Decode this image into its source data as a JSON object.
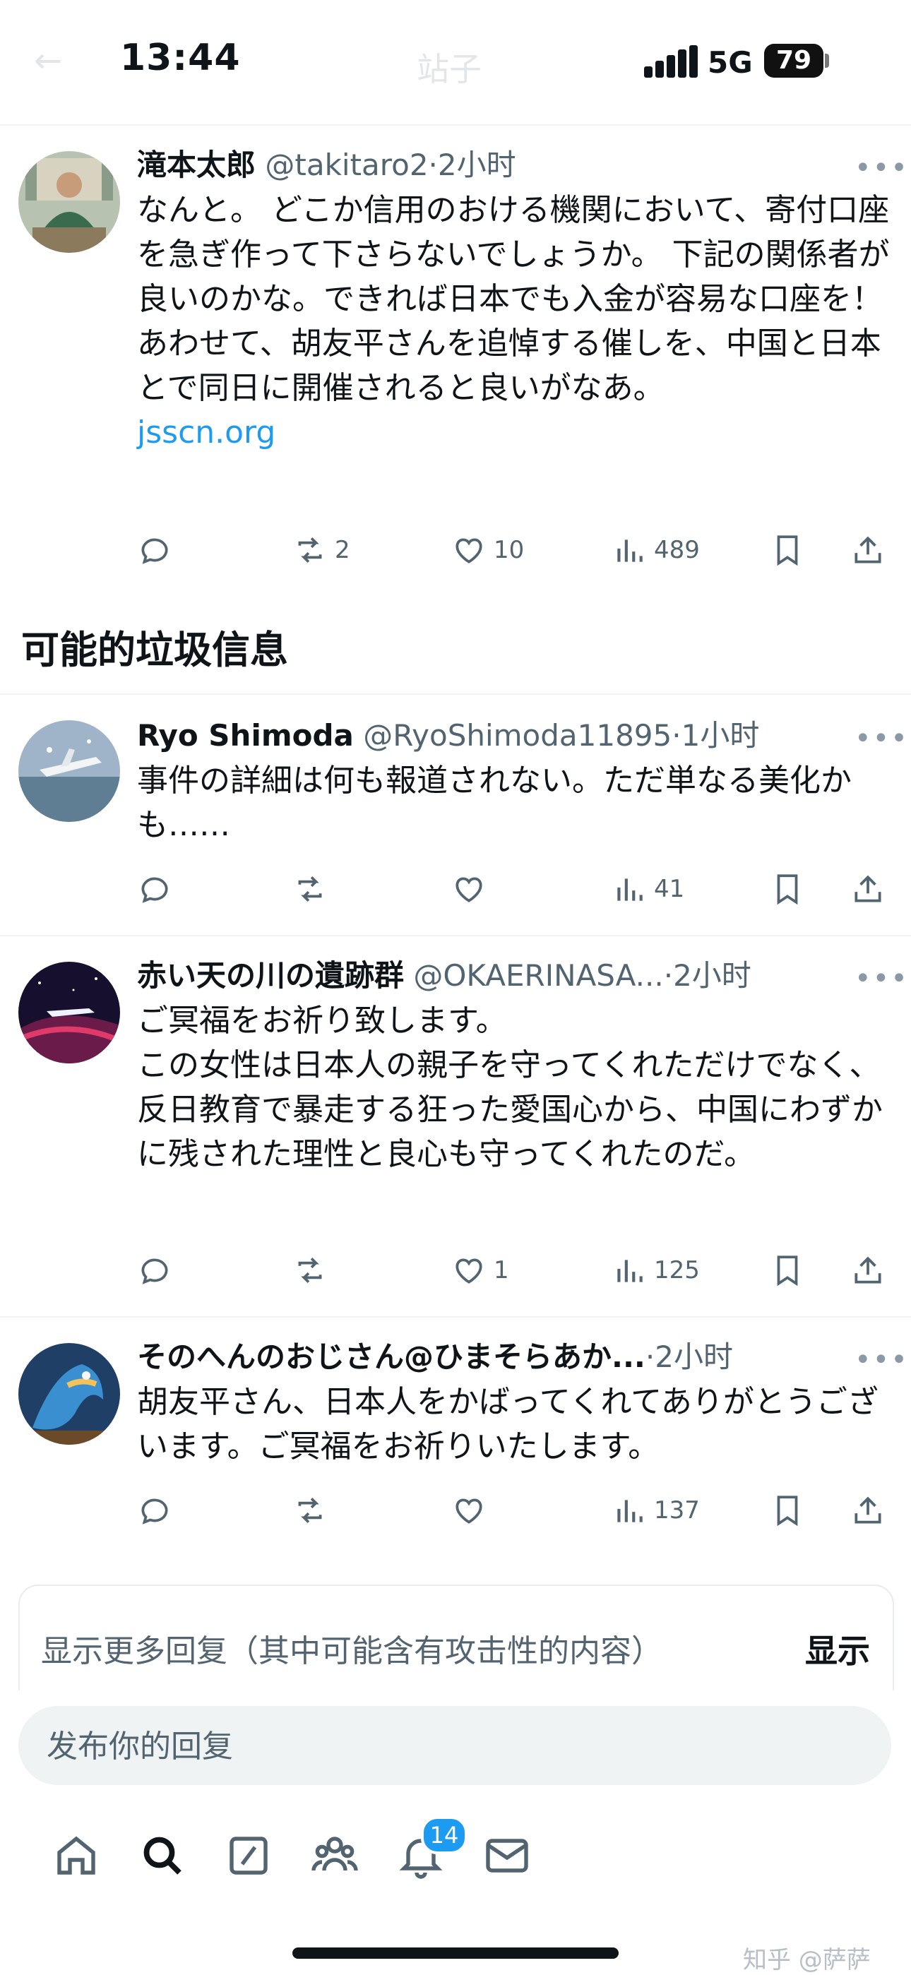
{
  "status_bar": {
    "time": "13:44",
    "network": "5G",
    "battery": "79",
    "ghost_title": "站子"
  },
  "tweets": [
    {
      "name": "滝本太郎",
      "handle": "@takitaro2",
      "time": "2小时",
      "lines": [
        "なんと。 どこか信用のおける機関において、寄付口座を急ぎ作って下さらないでしょうか。 下記の関係者が良いのかな。できれば日本でも入金が容易な口座を！",
        "あわせて、胡友平さんを追悼する催しを、中国と日本とで同日に開催されると良いがなあ。"
      ],
      "link": "jsscn.org",
      "replies": "",
      "retweets": "2",
      "likes": "10",
      "views": "489"
    },
    {
      "name": "Ryo Shimoda",
      "handle": "@RyoShimoda11895",
      "time": "1小时",
      "lines": [
        "事件の詳細は何も報道されない。ただ単なる美化かも……"
      ],
      "replies": "",
      "retweets": "",
      "likes": "",
      "views": "41"
    },
    {
      "name": "赤い天の川の遺跡群",
      "handle": "@OKAERINASA...",
      "time": "2小时",
      "lines": [
        "ご冥福をお祈り致します。",
        "この女性は日本人の親子を守ってくれただけでなく、反日教育で暴走する狂った愛国心から、中国にわずかに残された理性と良心も守ってくれたのだ。"
      ],
      "replies": "",
      "retweets": "",
      "likes": "1",
      "views": "125"
    },
    {
      "name": "そのへんのおじさん@ひまそらあか...",
      "handle": "",
      "time": "2小时",
      "lines": [
        "胡友平さん、日本人をかばってくれてありがとうございます。ご冥福をお祈りいたします。"
      ],
      "replies": "",
      "retweets": "",
      "likes": "",
      "views": "137"
    }
  ],
  "section_title": "可能的垃圾信息",
  "more_replies": {
    "text": "显示更多回复（其中可能含有攻击性的内容）",
    "button": "显示"
  },
  "composer": {
    "placeholder": "发布你的回复"
  },
  "tabbar": {
    "notifications_badge": "14",
    "icons": [
      "home-icon",
      "search-icon",
      "compose-icon",
      "communities-icon",
      "bell-icon",
      "mail-icon"
    ]
  },
  "watermark": "知乎 @萨萨",
  "colors": {
    "text": "#0f1419",
    "secondary": "#536471",
    "accent": "#1d9bf0",
    "divider": "#eff3f4"
  }
}
